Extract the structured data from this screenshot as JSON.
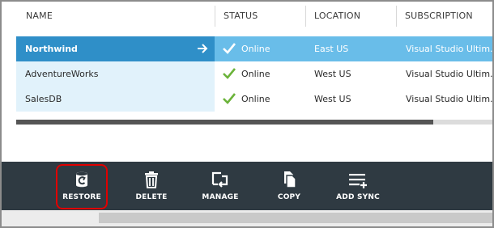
{
  "columns": {
    "name": "NAME",
    "status": "STATUS",
    "location": "LOCATION",
    "subscription": "SUBSCRIPTION"
  },
  "rows": [
    {
      "name": "Northwind",
      "status": "Online",
      "location": "East US",
      "subscription": "Visual Studio Ultim..."
    },
    {
      "name": "AdventureWorks",
      "status": "Online",
      "location": "West US",
      "subscription": "Visual Studio Ultim..."
    },
    {
      "name": "SalesDB",
      "status": "Online",
      "location": "West US",
      "subscription": "Visual Studio Ultim..."
    }
  ],
  "commands": {
    "restore": "RESTORE",
    "delete": "DELETE",
    "manage": "MANAGE",
    "copy": "COPY",
    "add_sync": "ADD SYNC"
  },
  "colors": {
    "selected_row": "#2f8fc8",
    "selected_row_light": "#69bde9",
    "status_check": "#6bb33a",
    "command_bar": "#2f3a42",
    "highlight": "#e00000"
  },
  "icons": {
    "status": "checkmark-icon",
    "row_action": "arrow-right-icon",
    "restore": "restore-icon",
    "delete": "trash-icon",
    "manage": "manage-icon",
    "copy": "copy-icon",
    "add_sync": "add-sync-icon"
  }
}
